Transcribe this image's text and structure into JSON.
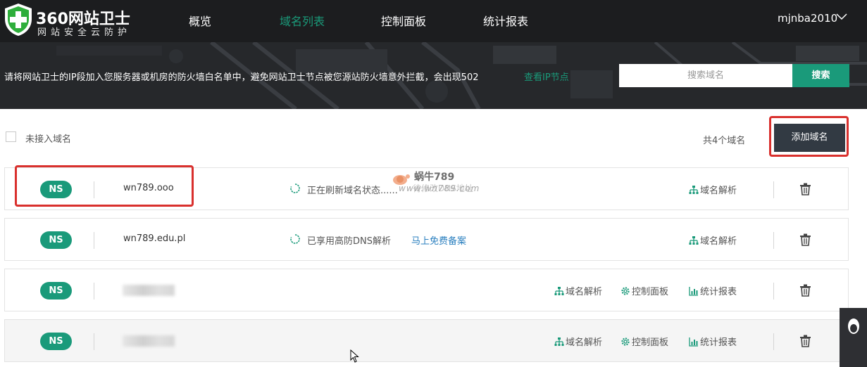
{
  "header": {
    "logo_title": "360网站卫士",
    "logo_subtitle": "网站安全云防护",
    "nav": [
      "概览",
      "域名列表",
      "控制面板",
      "统计报表"
    ],
    "active_nav": "域名列表",
    "username": "mjnba2010"
  },
  "banner": {
    "notice": "请将网站卫士的IP段加入您服务器或机房的防火墙白名单中，避免网站卫士节点被您源站防火墙意外拦截，会出现502",
    "notice_link": "查看IP节点",
    "search_placeholder": "搜索域名",
    "search_button": "搜索"
  },
  "toolbar": {
    "filter_label": "未接入域名",
    "count_text": "共4个域名",
    "add_button": "添加域名"
  },
  "watermark": {
    "line1": "蜗牛789",
    "line2": "www.wn789.com",
    "line3": "待修改DNS地址"
  },
  "domains": [
    {
      "badge": "NS",
      "name": "wn789.ooo",
      "status": "正在刷新域名状态......",
      "actions": [
        "域名解析"
      ]
    },
    {
      "badge": "NS",
      "name": "wn789.edu.pl",
      "status": "已享用高防DNS解析",
      "extra_link": "马上免费备案",
      "actions": [
        "域名解析"
      ]
    },
    {
      "badge": "NS",
      "name": "",
      "actions": [
        "域名解析",
        "控制面板",
        "统计报表"
      ]
    },
    {
      "badge": "NS",
      "name": "",
      "actions": [
        "域名解析",
        "控制面板",
        "统计报表"
      ]
    }
  ],
  "colors": {
    "accent": "#1a9a7a",
    "header_bg": "#1c1d1f",
    "add_button_bg": "#323a43",
    "highlight_border": "#d9302d",
    "link": "#2a7fbf"
  },
  "icons": {
    "dns": "sitemap-icon",
    "panel": "gear-icon",
    "report": "bar-chart-icon",
    "delete": "trash-icon",
    "status": "refresh-icon"
  }
}
